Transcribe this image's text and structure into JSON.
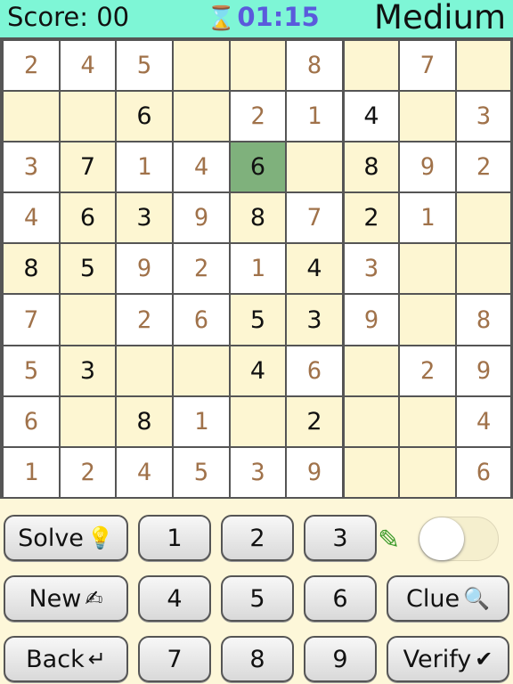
{
  "header": {
    "score_label": "Score: 00",
    "timer": "01:15",
    "level": "Medium"
  },
  "grid": [
    [
      "2",
      "4",
      "5",
      "",
      "",
      "8",
      "",
      "7",
      ""
    ],
    [
      "",
      "",
      "6",
      "",
      "2",
      "1",
      "4",
      "",
      "3"
    ],
    [
      "3",
      "7",
      "1",
      "4",
      "6",
      "",
      "8",
      "9",
      "2"
    ],
    [
      "4",
      "6",
      "3",
      "9",
      "8",
      "7",
      "2",
      "1",
      ""
    ],
    [
      "8",
      "5",
      "9",
      "2",
      "1",
      "4",
      "3",
      "",
      ""
    ],
    [
      "7",
      "",
      "2",
      "6",
      "5",
      "3",
      "9",
      "",
      "8"
    ],
    [
      "5",
      "3",
      "",
      "",
      "4",
      "6",
      "",
      "2",
      "9"
    ],
    [
      "6",
      "",
      "8",
      "1",
      "",
      "2",
      "",
      "",
      "4"
    ],
    [
      "1",
      "2",
      "4",
      "5",
      "3",
      "9",
      "",
      "",
      "6"
    ]
  ],
  "given": [
    [
      0,
      0,
      0,
      0,
      0,
      0,
      0,
      0,
      0
    ],
    [
      0,
      0,
      1,
      0,
      0,
      0,
      1,
      0,
      0
    ],
    [
      0,
      1,
      0,
      0,
      1,
      0,
      1,
      0,
      0
    ],
    [
      0,
      1,
      1,
      0,
      1,
      0,
      1,
      0,
      0
    ],
    [
      1,
      1,
      0,
      0,
      0,
      1,
      0,
      0,
      0
    ],
    [
      0,
      0,
      0,
      0,
      1,
      1,
      0,
      0,
      0
    ],
    [
      0,
      1,
      0,
      0,
      1,
      0,
      0,
      0,
      0
    ],
    [
      0,
      0,
      1,
      0,
      0,
      1,
      0,
      0,
      0
    ],
    [
      0,
      0,
      0,
      0,
      0,
      0,
      0,
      0,
      0
    ]
  ],
  "selected": {
    "row": 2,
    "col": 4
  },
  "controls": {
    "solve": "Solve",
    "new": "New",
    "back": "Back",
    "clue": "Clue",
    "verify": "Verify",
    "digits": [
      "1",
      "2",
      "3",
      "4",
      "5",
      "6",
      "7",
      "8",
      "9"
    ],
    "pencil_mode_on": false
  },
  "icons": {
    "timer": "hourglass-icon",
    "solve": "lightbulb-icon",
    "new": "writing-hand-icon",
    "back": "return-arrow-icon",
    "clue": "magnifier-icon",
    "verify": "checkmark-icon",
    "pencil": "pencil-icon"
  }
}
